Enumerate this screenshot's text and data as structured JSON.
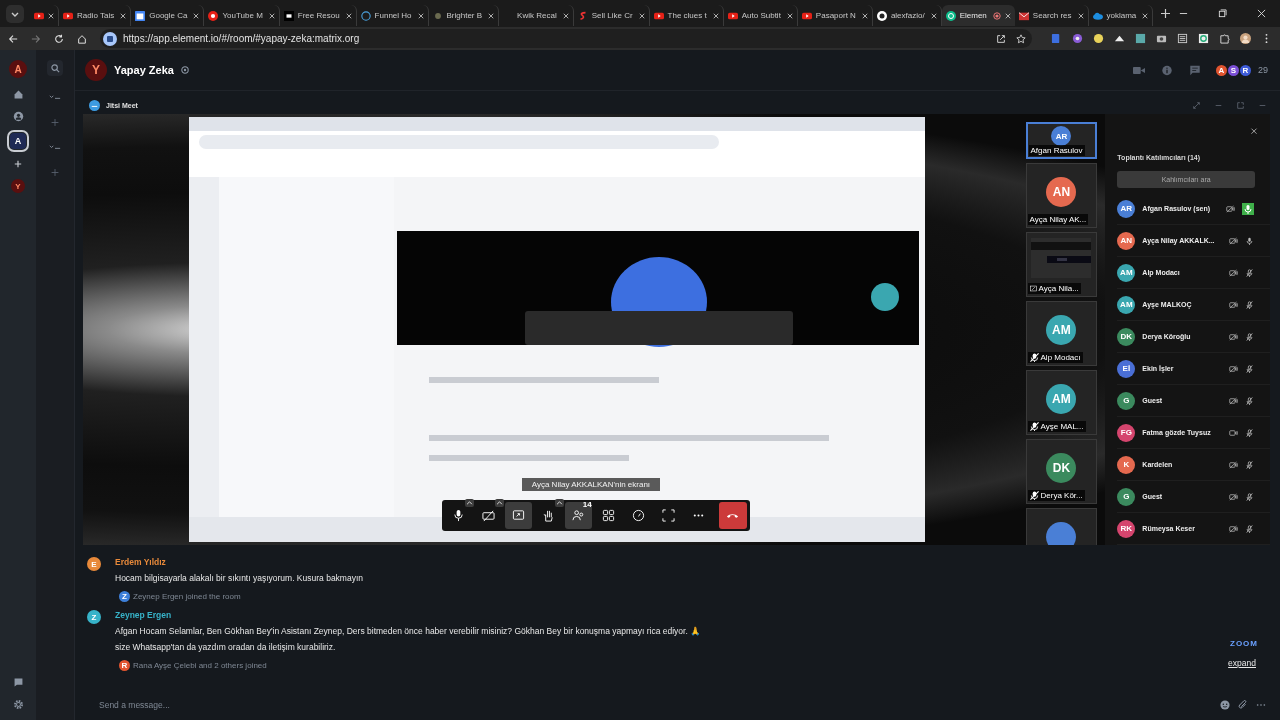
{
  "browser": {
    "tabs": [
      {
        "kind": "youtube",
        "selected": false
      },
      {
        "title": "Radio Tais",
        "kind": "youtube",
        "selected": false
      },
      {
        "title": "Google Ca",
        "kind": "calendar",
        "selected": false
      },
      {
        "title": "YouTube M",
        "kind": "circle",
        "selected": false
      },
      {
        "title": "Free Resou",
        "kind": "square",
        "selected": false
      },
      {
        "title": "Funnel Ho",
        "kind": "ring",
        "selected": false
      },
      {
        "title": "Brighter B",
        "kind": "dot",
        "selected": false
      },
      {
        "title": "Kwik Recal",
        "kind": "blank",
        "selected": false
      },
      {
        "title": "Sell Like Cr",
        "kind": "letter",
        "selected": false
      },
      {
        "title": "The clues t",
        "kind": "youtube",
        "selected": false
      },
      {
        "title": "Auto Subtit",
        "kind": "youtube",
        "selected": false
      },
      {
        "title": "Pasaport N",
        "kind": "youtube",
        "selected": false
      },
      {
        "title": "alexfazio/",
        "kind": "github",
        "selected": false
      },
      {
        "title": "Elemen",
        "kind": "element",
        "selected": true
      },
      {
        "title": "Search res",
        "kind": "mail",
        "selected": false
      },
      {
        "title": "yoklama",
        "kind": "cloud",
        "selected": false
      }
    ],
    "url": "https://app.element.io/#/room/#yapay-zeka:matrix.org"
  },
  "spaces": {
    "user_initial": "A",
    "space_initial": "A",
    "room_initial": "Y"
  },
  "room": {
    "initial": "Y",
    "name": "Yapay Zeka",
    "member_initials": [
      {
        "letter": "A",
        "color": "#e0542f"
      },
      {
        "letter": "S",
        "color": "#7b4fd6"
      },
      {
        "letter": "R",
        "color": "#3d5bd9"
      }
    ],
    "member_count": "29"
  },
  "widget": {
    "title": "Jitsi Meet"
  },
  "call": {
    "tooltip": "Ayça Nilay AKKALKAN'nin ekranı",
    "toolbar": [
      {
        "kind": "mic",
        "caret": true,
        "selected": false
      },
      {
        "kind": "camera-off",
        "caret": true,
        "selected": false
      },
      {
        "kind": "share",
        "caret": false,
        "selected": true
      },
      {
        "kind": "hand",
        "caret": true,
        "selected": false
      },
      {
        "kind": "participants",
        "caret": false,
        "selected": true,
        "badge": "14"
      },
      {
        "kind": "grid",
        "caret": false,
        "selected": false
      },
      {
        "kind": "gauge",
        "caret": false,
        "selected": false
      },
      {
        "kind": "fullscreen",
        "caret": false,
        "selected": false
      },
      {
        "kind": "more",
        "caret": false,
        "selected": false
      },
      {
        "kind": "hangup",
        "caret": false,
        "selected": false
      }
    ],
    "filmstrip": [
      {
        "kind": "avatar",
        "initials": "AR",
        "name": "Afgan Rasulov",
        "color": "#4a7fd6",
        "selected": true,
        "muted": false
      },
      {
        "kind": "avatar",
        "initials": "AN",
        "name": "Ayça Nilay AK...",
        "color": "#e5694f",
        "selected": false,
        "muted": false
      },
      {
        "kind": "screen",
        "name": "Ayça Nila...",
        "selected": false,
        "muted": false
      },
      {
        "kind": "avatar",
        "initials": "AM",
        "name": "Alp Modacı",
        "color": "#3aa7b0",
        "selected": false,
        "muted": true
      },
      {
        "kind": "avatar",
        "initials": "AM",
        "name": "Ayşe MAL...",
        "color": "#3aa7b0",
        "selected": false,
        "muted": true
      },
      {
        "kind": "avatar",
        "initials": "DK",
        "name": "Derya Kör...",
        "color": "#3b8a5e",
        "selected": false,
        "muted": true
      },
      {
        "kind": "avatar",
        "color": "#4a7fd6",
        "selected": false
      }
    ],
    "participants": {
      "title": "Toplantı Katılımcıları (14)",
      "search_label": "Kahlımcıları ara",
      "rows": [
        {
          "initials": "AR",
          "name": "Afgan Rasulov (sen)",
          "color": "#4a7fd6",
          "camera_off": true,
          "speaking": true,
          "muted": false
        },
        {
          "initials": "AN",
          "name": "Ayça Nilay AKKALK...",
          "color": "#e5694f",
          "camera_off": true,
          "speaking": false,
          "muted": false
        },
        {
          "initials": "AM",
          "name": "Alp Modacı",
          "color": "#3aa7b0",
          "camera_off": true,
          "speaking": false,
          "muted": true
        },
        {
          "initials": "AM",
          "name": "Ayşe MALKOÇ",
          "color": "#3aa7b0",
          "camera_off": true,
          "speaking": false,
          "muted": true
        },
        {
          "initials": "DK",
          "name": "Derya Köroğlu",
          "color": "#3b8a5e",
          "camera_off": true,
          "speaking": false,
          "muted": true
        },
        {
          "initials": "Eİ",
          "name": "Ekin İşler",
          "color": "#4a6fd6",
          "camera_off": true,
          "speaking": false,
          "muted": true
        },
        {
          "initials": "G",
          "name": "Guest",
          "color": "#3b8a5e",
          "camera_off": true,
          "speaking": false,
          "muted": true
        },
        {
          "initials": "FG",
          "name": "Fatma gözde Tuysuz",
          "color": "#d5456e",
          "camera_off": false,
          "speaking": false,
          "muted": true
        },
        {
          "initials": "K",
          "name": "Kardelen",
          "color": "#e5694f",
          "camera_off": true,
          "speaking": false,
          "muted": true
        },
        {
          "initials": "G",
          "name": "Guest",
          "color": "#3b8a5e",
          "camera_off": true,
          "speaking": false,
          "muted": true
        },
        {
          "initials": "RK",
          "name": "Rümeysa Keser",
          "color": "#d5456e",
          "camera_off": true,
          "speaking": false,
          "muted": true
        }
      ]
    }
  },
  "timeline": [
    {
      "kind": "message",
      "initial": "E",
      "sender": "Erdem Yıldız",
      "color": "#e8893a",
      "lines": [
        "Hocam bilgisayarla alakalı bir sıkıntı yaşıyorum. Kusura bakmayın"
      ]
    },
    {
      "kind": "notice",
      "initial": "Z",
      "text": "Zeynep Ergen joined the room",
      "color": "#3d7fd9"
    },
    {
      "kind": "message",
      "initial": "Z",
      "sender": "Zeynep Ergen",
      "color": "#37b3c9",
      "lines": [
        "Afgan Hocam Selamlar, Ben Gökhan Bey'in Asistanı Zeynep, Ders bitmeden önce haber verebilir misiniz? Gökhan Bey bir konuşma yapmayı rica ediyor. 🙏",
        "size Whatsapp'tan da yazdım oradan da iletişim kurabiliriz."
      ]
    },
    {
      "kind": "notice",
      "initial": "R",
      "text": "Rana Ayşe Çelebi and 2 others joined",
      "color": "#e0542f"
    }
  ],
  "zoom_mark": "ZOOM",
  "expand_link": "expand",
  "composer": {
    "placeholder": "Send a message..."
  }
}
